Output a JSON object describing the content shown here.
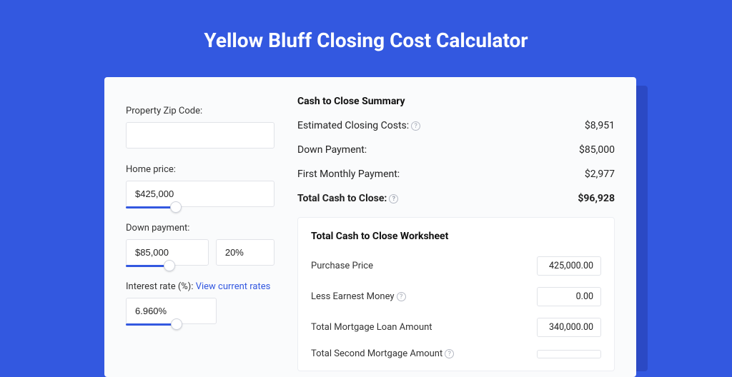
{
  "title": "Yellow Bluff Closing Cost Calculator",
  "left": {
    "zip_label": "Property Zip Code:",
    "zip_value": "",
    "home_price_label": "Home price:",
    "home_price_value": "$425,000",
    "down_payment_label": "Down payment:",
    "down_payment_value": "$85,000",
    "down_payment_pct": "20%",
    "rate_label_prefix": "Interest rate (%): ",
    "rate_link": "View current rates",
    "rate_value": "6.960%"
  },
  "summary": {
    "heading": "Cash to Close Summary",
    "rows": [
      {
        "label": "Estimated Closing Costs:",
        "help": true,
        "value": "$8,951",
        "bold": false
      },
      {
        "label": "Down Payment:",
        "help": false,
        "value": "$85,000",
        "bold": false
      },
      {
        "label": "First Monthly Payment:",
        "help": false,
        "value": "$2,977",
        "bold": false
      },
      {
        "label": "Total Cash to Close:",
        "help": true,
        "value": "$96,928",
        "bold": true
      }
    ]
  },
  "worksheet": {
    "heading": "Total Cash to Close Worksheet",
    "rows": [
      {
        "label": "Purchase Price",
        "help": false,
        "value": "425,000.00"
      },
      {
        "label": "Less Earnest Money",
        "help": true,
        "value": "0.00"
      },
      {
        "label": "Total Mortgage Loan Amount",
        "help": false,
        "value": "340,000.00"
      },
      {
        "label": "Total Second Mortgage Amount",
        "help": true,
        "value": ""
      }
    ]
  }
}
